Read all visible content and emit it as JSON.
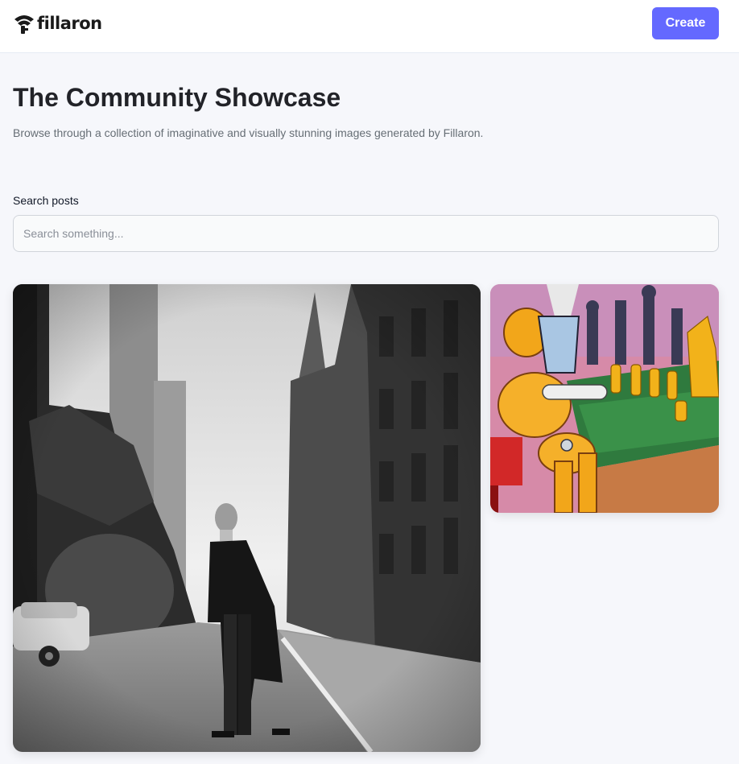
{
  "header": {
    "logo_text": "fillaron",
    "create_label": "Create"
  },
  "intro": {
    "title": "The Community Showcase",
    "subtitle": "Browse through a collection of imaginative and visually stunning images generated by Fillaron."
  },
  "search": {
    "label": "Search posts",
    "placeholder": "Search something...",
    "value": ""
  },
  "gallery": {
    "posts": [
      {
        "subject": "black-and-white city street with man in long coat"
      },
      {
        "subject": "cubist painting of robot playing chess"
      }
    ]
  },
  "colors": {
    "accent": "#6469ff",
    "background": "#f6f7fb",
    "title": "#222328",
    "subtitle": "#666e75"
  }
}
